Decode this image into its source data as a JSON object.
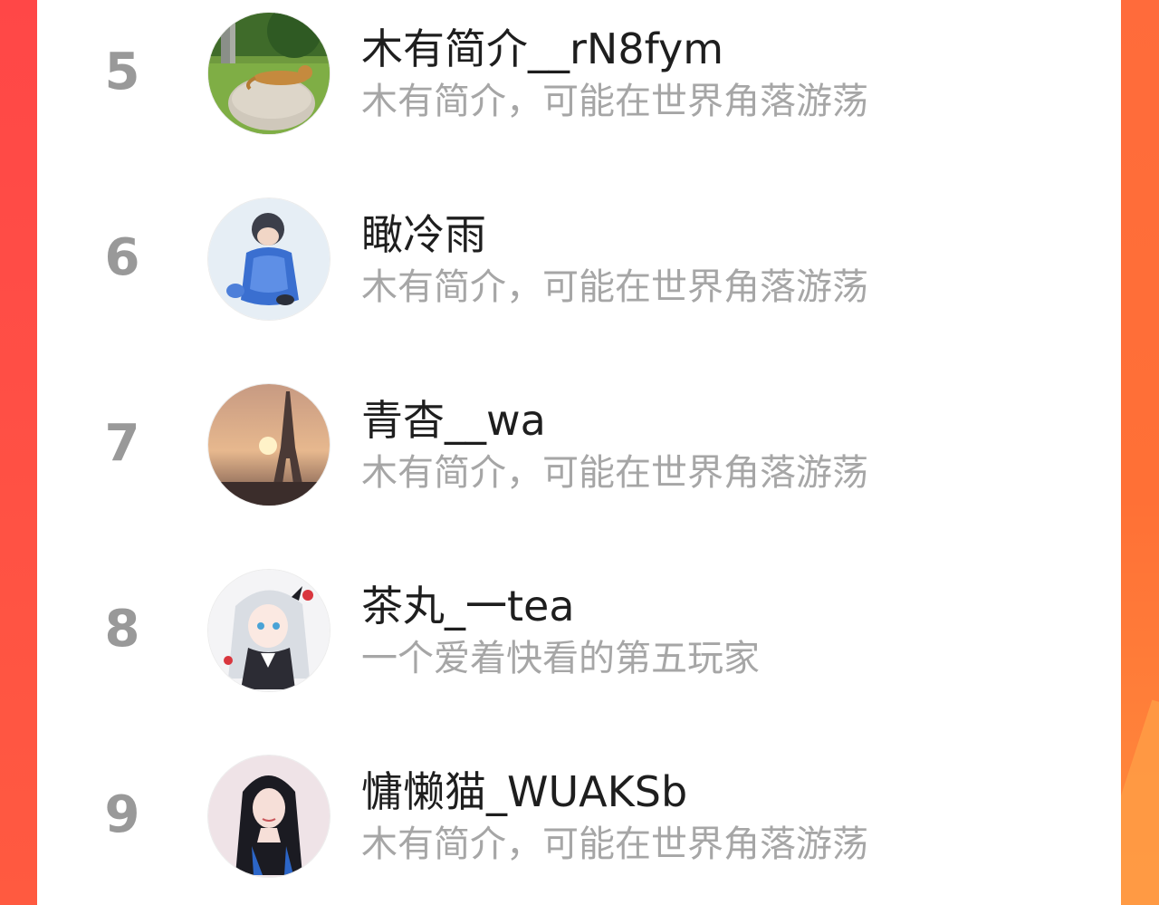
{
  "colors": {
    "accent_left": "#ff4747",
    "accent_right": "#ff7036",
    "card": "#ffffff",
    "rank_text": "#999999",
    "name_text": "#1e1e1e",
    "bio_text": "#a6a6a6"
  },
  "ranking": {
    "entries": [
      {
        "rank": "5",
        "name": "木有简介__rN8fym",
        "bio": "木有简介，可能在世界角落游荡",
        "avatar_icon": "cat-on-rock-avatar"
      },
      {
        "rank": "6",
        "name": "瞰冷雨",
        "bio": "木有简介，可能在世界角落游荡",
        "avatar_icon": "child-in-blue-avatar"
      },
      {
        "rank": "7",
        "name": "青杳__wa",
        "bio": "木有简介，可能在世界角落游荡",
        "avatar_icon": "eiffel-tower-sunset-avatar"
      },
      {
        "rank": "8",
        "name": "茶丸_一tea",
        "bio": "一个爱着快看的第五玩家",
        "avatar_icon": "anime-maid-avatar"
      },
      {
        "rank": "9",
        "name": "慵懒猫_WUAKSb",
        "bio": "木有简介，可能在世界角落游荡",
        "avatar_icon": "woman-portrait-avatar"
      }
    ]
  }
}
